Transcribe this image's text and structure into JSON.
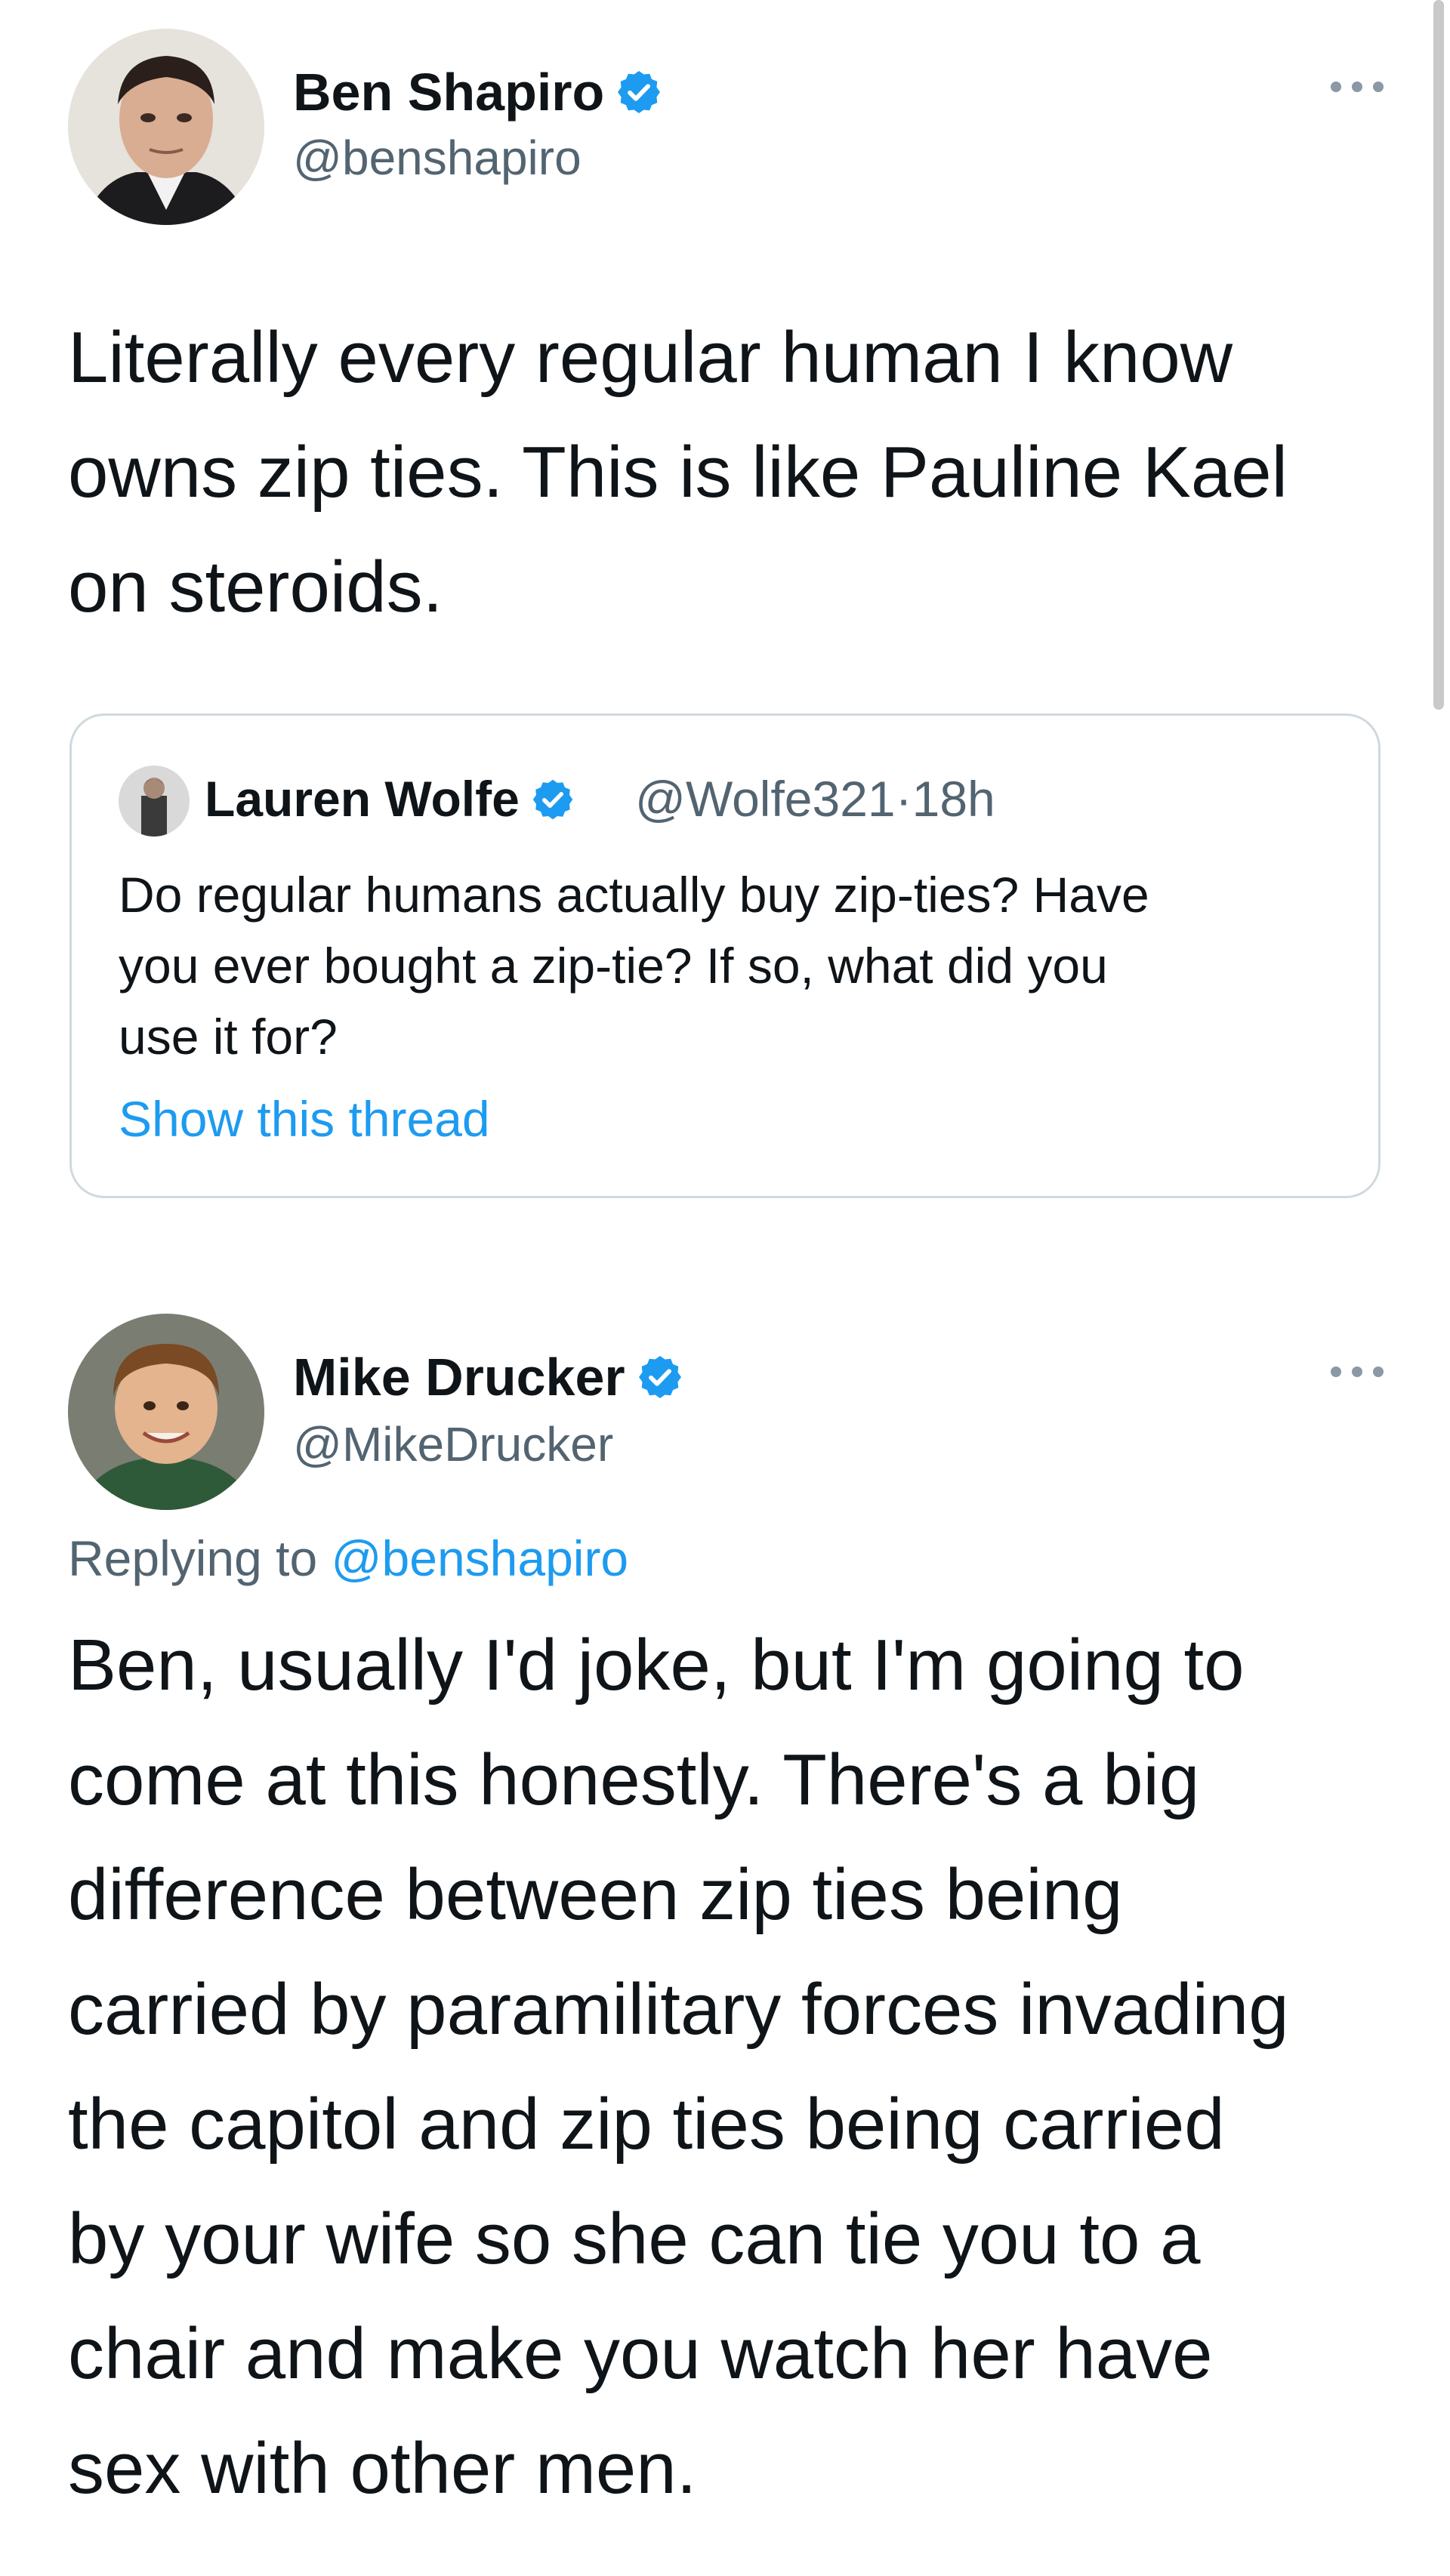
{
  "tweets": [
    {
      "display_name": "Ben Shapiro",
      "handle": "@benshapiro",
      "verified": true,
      "more_icon": "more-horizontal-icon",
      "text": "Literally every regular human I know\nowns zip ties. This is like Pauline Kael\non steroids.",
      "quote": {
        "display_name": "Lauren Wolfe",
        "verified": true,
        "handle": "@Wolfe321",
        "separator": "·",
        "time": "18h",
        "text": "Do regular humans actually buy zip-ties? Have\nyou ever bought a zip-tie? If so, what did you\nuse it for?",
        "show_thread": "Show this thread"
      }
    },
    {
      "display_name": "Mike Drucker",
      "handle": "@MikeDrucker",
      "verified": true,
      "more_icon": "more-horizontal-icon",
      "replying_prefix": "Replying to",
      "replying_to": "@benshapiro",
      "text": "Ben, usually I'd joke, but I'm going to\ncome at this honestly. There's a big\ndifference between zip ties being\ncarried by paramilitary forces invading\nthe capitol and zip ties being carried\nby your wife so she can tie you to a\nchair and make you watch her have\nsex with other men."
    }
  ],
  "colors": {
    "verified_blue": "#1d9bf0",
    "link_blue": "#1d9bf0",
    "secondary_text": "#536471",
    "border": "#cfd9de"
  }
}
